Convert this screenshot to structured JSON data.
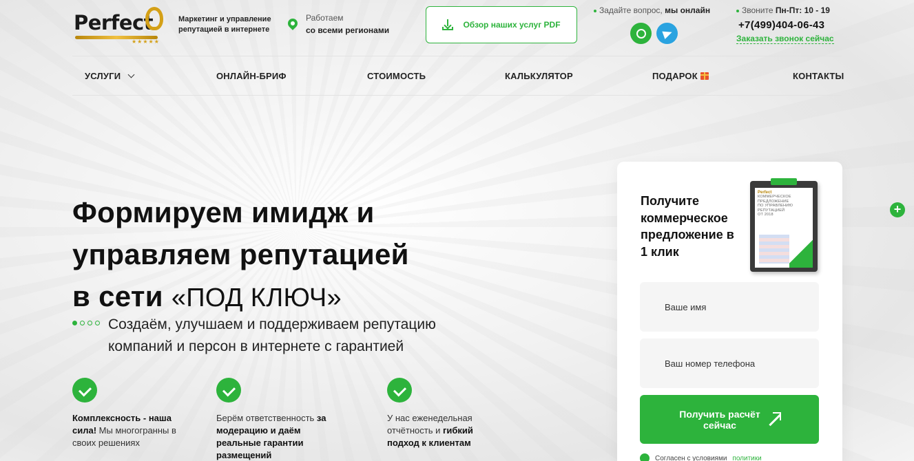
{
  "header": {
    "logo_text": "Perfect",
    "logo_stars": "★★★★★",
    "tagline_line1": "Маркетинг и управление",
    "tagline_line2": "репутацией в интернете",
    "work_top": "Работаем",
    "work_bottom": "со всеми регионами",
    "pdf_button": "Обзор наших услуг PDF",
    "ask_text": "Задайте вопрос,",
    "ask_bold": "мы онлайн",
    "call_text": "Звоните",
    "call_hours": "Пн-Пт: 10 - 19",
    "phone": "+7(499)404-06-43",
    "order_call": "Заказать звонок сейчас"
  },
  "nav": {
    "services": "УСЛУГИ",
    "brief": "ОНЛАЙН-БРИФ",
    "price": "СТОИМОСТЬ",
    "calculator": "КАЛЬКУЛЯТОР",
    "gift": "ПОДАРОК",
    "contacts": "КОНТАКТЫ"
  },
  "hero": {
    "title_line1": "Формируем имидж и",
    "title_line2": "управляем репутацией",
    "title_line3_bold": "в сети",
    "title_line3_light": "«ПОД КЛЮЧ»",
    "subtitle_line1": "Создаём, улучшаем и поддерживаем репутацию",
    "subtitle_line2": "компаний и персон в интернете с гарантией"
  },
  "features": [
    {
      "bold1": "Комплексность - наша сила!",
      "text": " Мы многогранны в своих решениях"
    },
    {
      "text1": "Берём ответственность ",
      "bold": "за модерацию и даём реальные гарантии размещений"
    },
    {
      "text1": "У нас еженедельная отчётность и ",
      "bold": "гибкий подход к клиентам"
    }
  ],
  "form": {
    "title": "Получите коммерческое предложение в 1 клик",
    "name_placeholder": "Ваше имя",
    "phone_placeholder": "Ваш номер телефона",
    "submit": "Получить расчёт сейчас",
    "agree_text": "Согласен с условиями",
    "agree_link": "политики",
    "doc_logo": "Perfect",
    "doc_lines": [
      "КОММЕРЧЕСКОЕ",
      "ПРЕДЛОЖЕНИЕ",
      "ПО УПРАВЛЕНИЮ",
      "РЕПУТАЦИЕЙ",
      "ОТ 2018"
    ]
  },
  "side": {
    "plus": "+"
  },
  "colors": {
    "accent": "#2db33c",
    "telegram": "#2aa3e0",
    "logo_gold": "#d4a017"
  },
  "icons": [
    "map-pin-icon",
    "download-icon",
    "whatsapp-icon",
    "telegram-icon",
    "chevron-down-icon",
    "gift-icon",
    "check-icon",
    "arrow-up-right-icon",
    "plus-icon"
  ]
}
